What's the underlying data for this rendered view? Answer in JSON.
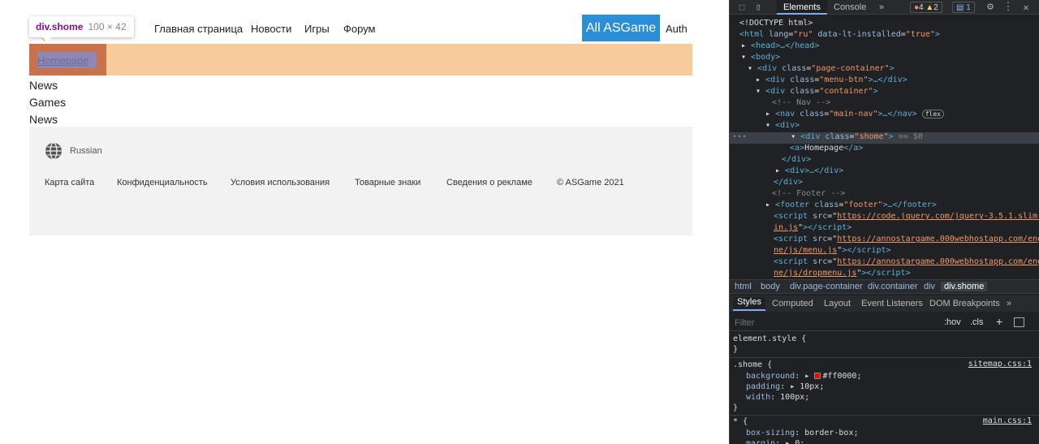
{
  "tooltip": {
    "element": "div.shome",
    "size": "100 × 42"
  },
  "site": {
    "nav": [
      "Главная страница",
      "Новости",
      "Игры",
      "Форум"
    ],
    "brand_button": "All ASGame",
    "auth": "Auth",
    "shome_link": "Homepage",
    "lines": [
      "News",
      "Games",
      "News"
    ],
    "footer": {
      "language": "Russian",
      "links": [
        "Карта сайта",
        "Конфиденциальность",
        "Условия использования",
        "Товарные знаки",
        "Сведения о рекламе",
        "© ASGame 2021"
      ]
    }
  },
  "devtools": {
    "tabs": {
      "elements": "Elements",
      "console": "Console",
      "more": "»"
    },
    "badges": {
      "errors": "4",
      "warnings": "2",
      "messages": "1"
    },
    "dom": {
      "doctype": "<!DOCTYPE html>",
      "html_tag": "html",
      "html_lang_attr": "lang",
      "html_lang_val": "\"ru\"",
      "html_lt_attr": "data-lt-installed",
      "html_lt_val": "\"true\"",
      "head": "<head>…</head>",
      "body": "<body>",
      "page_container_val": "\"page-container\"",
      "menu_btn_val": "\"menu-btn\"",
      "container_val": "\"container\"",
      "nav_comment": "<!-- Nav -->",
      "main_nav_val": "\"main-nav\"",
      "flex_badge": "flex",
      "div_open": "<div>",
      "shome_val": "\"shome\"",
      "selected_marker": "== $0",
      "link_text": "Homepage",
      "div_close": "</div>",
      "div_collapsed": "<div>…</div>",
      "footer_comment": "<!-- Footer -->",
      "footer_val": "\"footer\"",
      "script1_a": "https://code.jquery.com/jquery-3.5.1.slim.m",
      "script1_b": "in.js",
      "script2_a": "https://annostargame.000webhostapp.com/engi",
      "script2_b": "ne/js/menu.js",
      "script3_a": "https://annostargame.000webhostapp.com/engi",
      "script3_b": "ne/js/dropmenu.js"
    },
    "breadcrumbs": [
      "html",
      "body",
      "div.page-container",
      "div.container",
      "div",
      "div.shome"
    ],
    "styles_tabs": [
      "Styles",
      "Computed",
      "Layout",
      "Event Listeners",
      "DOM Breakpoints",
      "»"
    ],
    "filter": {
      "placeholder": "Filter",
      "hov": ":hov",
      "cls": ".cls",
      "plus": "+"
    },
    "rules": {
      "element_style": "element.style {",
      "close": "}",
      "shome_selector": ".shome {",
      "shome_source": "sitemap.css:1",
      "background_prop": "background",
      "background_val": "#ff0000;",
      "background_color": "#ff0000",
      "padding_prop": "padding",
      "padding_val": "10px;",
      "width_prop": "width",
      "width_val": "100px;",
      "star_selector": "* {",
      "star_source": "main.css:1",
      "box_sizing_prop": "box-sizing",
      "box_sizing_val": "border-box;",
      "margin_prop": "margin",
      "margin_val": "0;"
    }
  }
}
